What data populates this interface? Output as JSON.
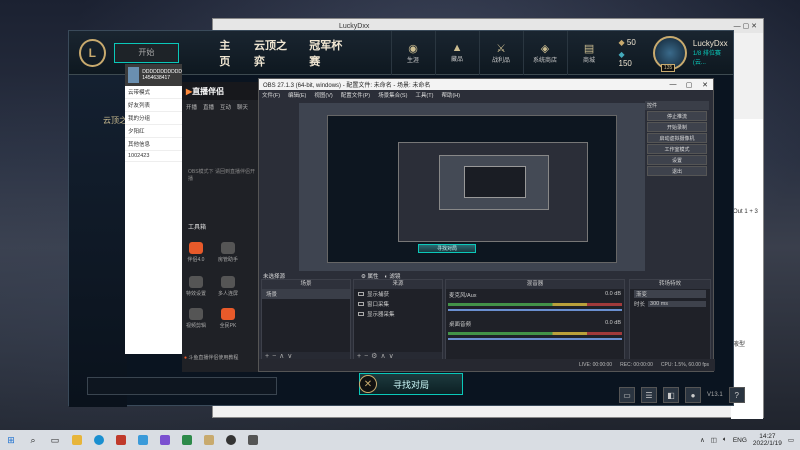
{
  "background_window": {
    "title": "LuckyDxx",
    "side_items": [
      "Out 1 + 3",
      "液型"
    ]
  },
  "lol": {
    "play_label": "开始",
    "nav": [
      "主页",
      "云顶之弈",
      "冠军杯赛"
    ],
    "icons": [
      {
        "name": "生涯",
        "icon": "profile-icon"
      },
      {
        "name": "藏品",
        "icon": "collection-icon"
      },
      {
        "name": "战利品",
        "icon": "loot-icon"
      },
      {
        "name": "系统商店",
        "icon": "store-icon"
      },
      {
        "name": "商城",
        "icon": "shop-icon"
      }
    ],
    "blue_essence": "50",
    "rp": "150",
    "username": "LuckyDxx",
    "status": "1/8 排位赛 (云...",
    "level": "135",
    "find_match": "寻找对局",
    "left_title": "云顶之",
    "version": "V13.1"
  },
  "chat": {
    "name": "DDDDDDDDDDD",
    "id": "1454638417",
    "mode": "云带模式",
    "groups": [
      "好友列表",
      "我的分组",
      "夕阳红",
      "其他信息",
      "1002423"
    ]
  },
  "companion": {
    "title": "直播伴侣",
    "tabs": [
      "开播",
      "直播",
      "互动",
      "聊天"
    ],
    "note": "OBS模式下 请回到直播伴侣开播",
    "tools_header": "工具箱",
    "tools": [
      "伴侣4.0",
      "房管助手",
      "特效设置",
      "多人连屏",
      "视频剪辑",
      "全民PK"
    ],
    "hint": "斗鱼直播伴侣使用教程"
  },
  "obs": {
    "title": "OBS 27.1.3 (64-bit, windows) - 配置文件: 未命名 - 场景: 未命名",
    "menu": [
      "文件(F)",
      "编辑(E)",
      "视图(V)",
      "配置文件(P)",
      "场景集合(S)",
      "工具(T)",
      "帮助(H)"
    ],
    "controls_header": "控件",
    "controls": [
      "停止推流",
      "开始录制",
      "启动虚拟摄像机",
      "工作室模式",
      "设置",
      "退出"
    ],
    "scene_tabs": [
      "未选择源",
      "属性",
      "滤镜"
    ],
    "docks": {
      "scenes": "场景",
      "sources": "来源",
      "mixer": "混音器",
      "transitions": "转场特效"
    },
    "scene_items": [
      "场景"
    ],
    "source_items": [
      "显示捕获",
      "窗口采集",
      "显示器采集"
    ],
    "mixer": [
      {
        "name": "麦克风/Aux",
        "db": "0.0 dB"
      },
      {
        "name": "桌面音频",
        "db": "0.0 dB"
      }
    ],
    "transition": "渐变",
    "duration_label": "时长",
    "duration": "300 ms",
    "status": [
      "LIVE: 00:00:00",
      "REC: 00:00:00",
      "CPU: 1.5%, 60.00 fps"
    ]
  },
  "taskbar": {
    "lang": "ENG",
    "time": "14:27",
    "date": "2022/1/19"
  }
}
